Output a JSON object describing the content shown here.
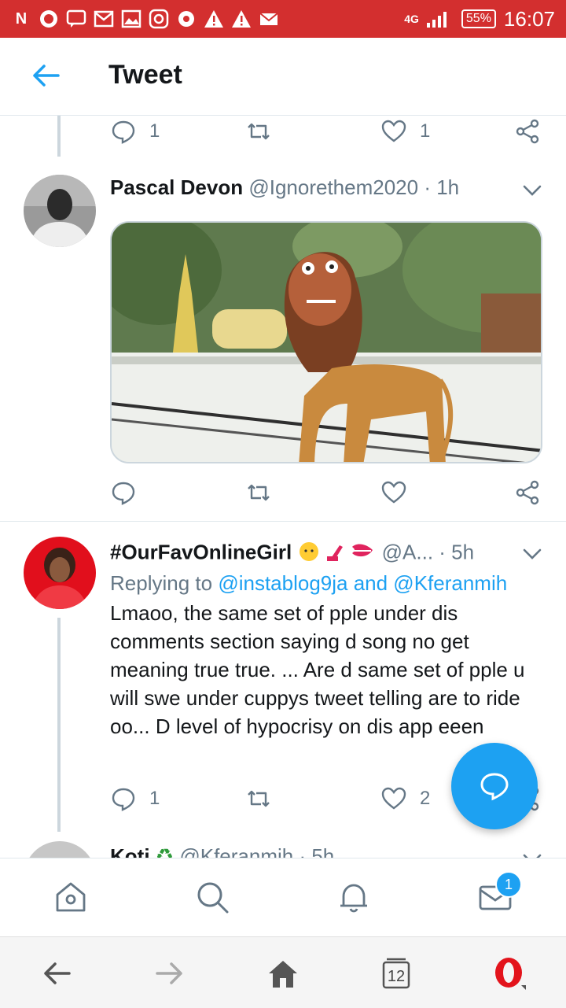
{
  "status_bar": {
    "left_icons": [
      "N",
      "whatsapp-icon",
      "message-icon",
      "gmail-icon",
      "gallery-icon",
      "instagram-icon",
      "opera-mini-icon",
      "warning-icon",
      "warning-icon",
      "mail-icon"
    ],
    "network": "4G",
    "battery": "55%",
    "time": "16:07"
  },
  "header": {
    "title": "Tweet"
  },
  "top_actions": {
    "reply_count": "1",
    "like_count": "1"
  },
  "tweet1": {
    "name": "Pascal Devon",
    "handle": "@Ignorethem2020",
    "time": "· 1h"
  },
  "tweet2": {
    "name": "#OurFavOnlineGirl",
    "handle": "@A...",
    "time": "· 5h",
    "replying_prefix": "Replying to ",
    "replying_users": "@instablog9ja and @Kferanmih",
    "text": "Lmaoo, the same set of  pple under dis comments section saying d song no get meaning true true. ... Are d same set of pple u will swe under cuppys tweet telling are to ride oo... D level of hypocrisy on dis app eeen",
    "reply_count": "1",
    "like_count": "2"
  },
  "tweet3": {
    "name": "Koti",
    "handle": "@Kferanmih",
    "time": "· 5h"
  },
  "tabbar": {
    "notification_badge": "1"
  },
  "browserbar": {
    "tab_count": "12"
  },
  "colors": {
    "accent": "#1da1f2",
    "statusbar": "#d32f2f",
    "muted": "#657786"
  }
}
